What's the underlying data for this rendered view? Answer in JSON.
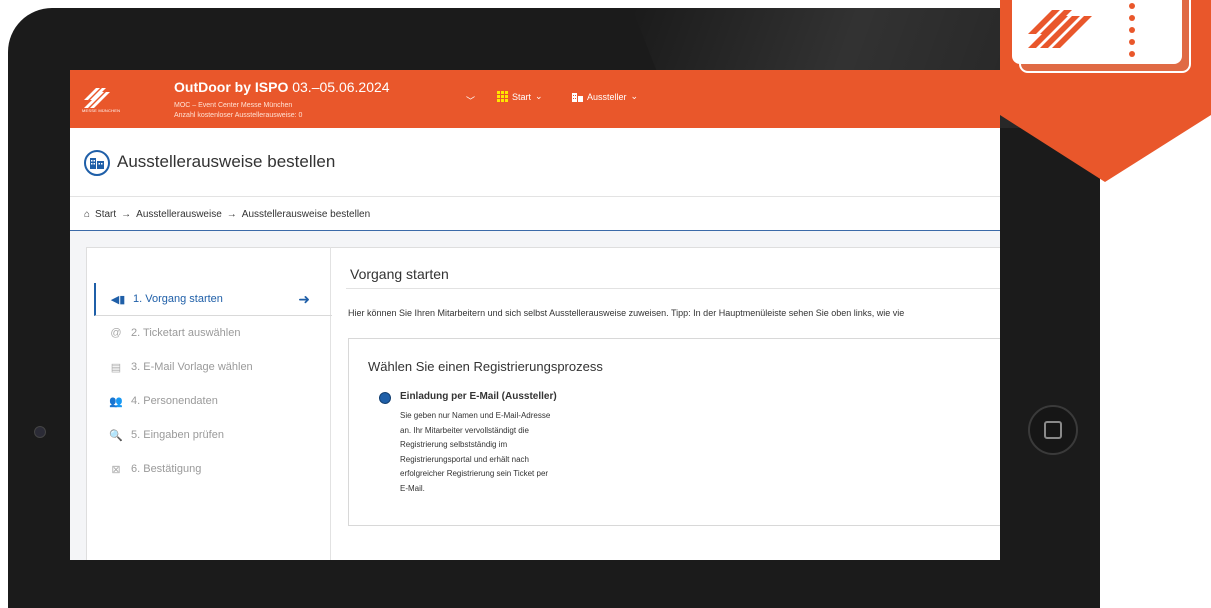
{
  "app": {
    "event_title": "OutDoor by ISPO",
    "event_dates": "03.–05.06.2024",
    "event_venue": "MOC – Event Center Messe München",
    "free_passes": "Anzahl kostenloser Ausstellerausweise: 0",
    "logo_text": "MESSE MÜNCHEN",
    "brand_color": "#e9572b",
    "accent_color": "#1f5fa8"
  },
  "nav": {
    "start_label": "Start",
    "exhibitor_label": "Aussteller"
  },
  "page": {
    "title": "Ausstellerausweise bestellen",
    "icon": "building-icon"
  },
  "breadcrumb": {
    "items": [
      "Start",
      "Ausstellerausweise",
      "Ausstellerausweise bestellen"
    ]
  },
  "steps": [
    {
      "label": "1. Vorgang starten",
      "icon": "megaphone-icon",
      "active": true
    },
    {
      "label": "2. Ticketart auswählen",
      "icon": "at-icon",
      "active": false
    },
    {
      "label": "3. E-Mail Vorlage wählen",
      "icon": "template-icon",
      "active": false
    },
    {
      "label": "4. Personendaten",
      "icon": "persons-icon",
      "active": false
    },
    {
      "label": "5. Eingaben prüfen",
      "icon": "search-icon",
      "active": false
    },
    {
      "label": "6. Bestätigung",
      "icon": "confirm-icon",
      "active": false
    }
  ],
  "main": {
    "section_title": "Vorgang starten",
    "intro": "Hier können Sie Ihren Mitarbeitern und sich selbst Ausstellerausweise zuweisen. Tipp: In der Hauptmenüleiste sehen Sie oben links, wie vie",
    "process_title": "Wählen Sie einen Registrierungsprozess",
    "option_label": "Einladung per E-Mail (Aussteller)",
    "option_lines": [
      "Sie geben nur Namen und E-Mail-Adresse",
      "an. Ihr Mitarbeiter vervollständigt die",
      "Registrierung selbstständig im",
      "Registrierungsportal und erhält nach",
      "erfolgreicher Registrierung sein Ticket per",
      "E-Mail."
    ]
  }
}
